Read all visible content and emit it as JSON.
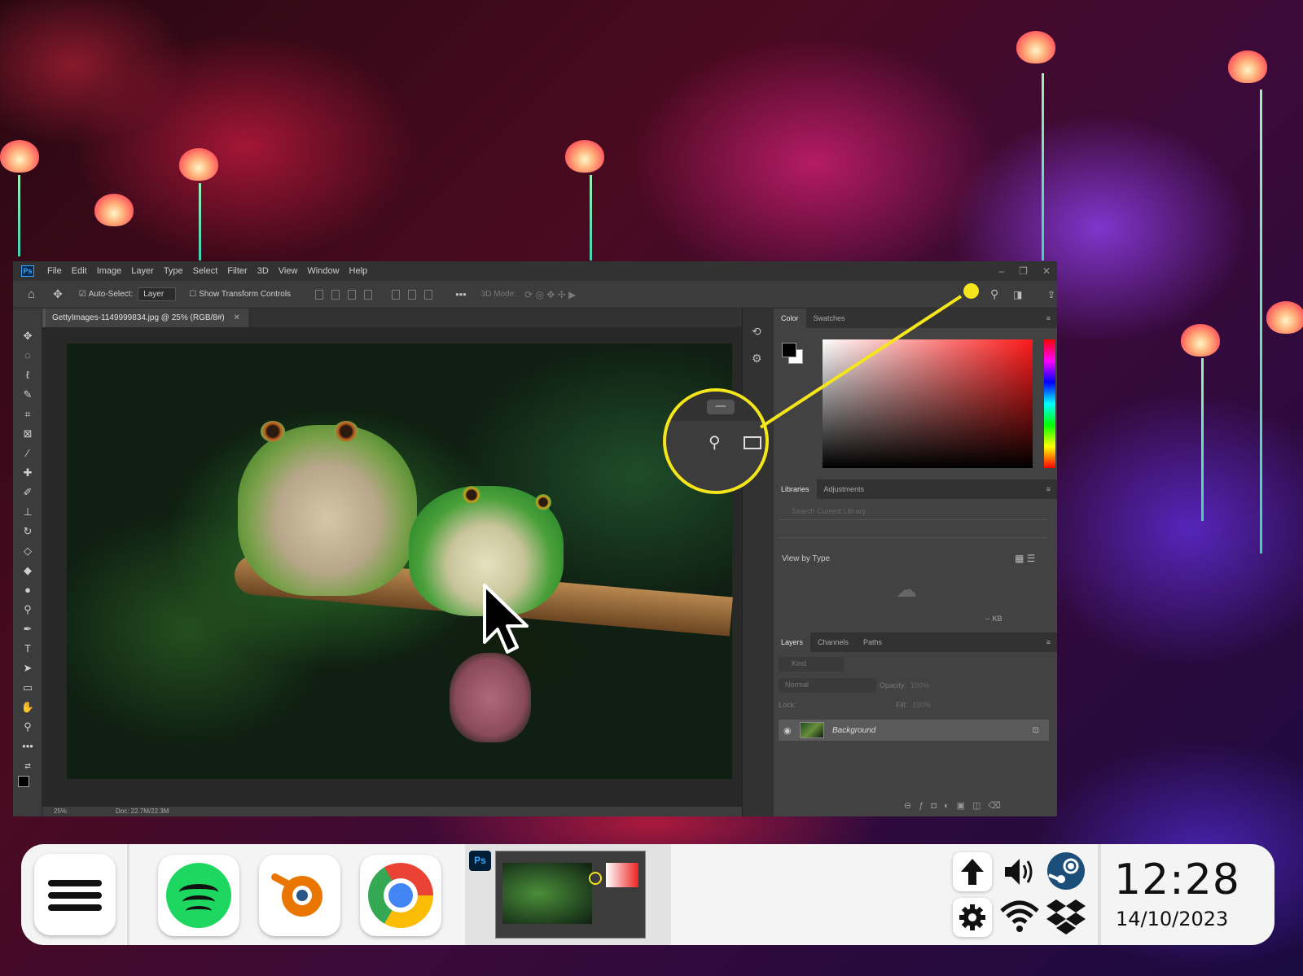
{
  "photoshop": {
    "logo": "Ps",
    "menu": [
      "File",
      "Edit",
      "Image",
      "Layer",
      "Type",
      "Select",
      "Filter",
      "3D",
      "View",
      "Window",
      "Help"
    ],
    "window_controls": {
      "minimize": "–",
      "restore": "❐",
      "close": "✕"
    },
    "options": {
      "auto_select_label": "Auto-Select:",
      "auto_select_value": "Layer",
      "transform_label": "Show Transform Controls",
      "mode_3d_label": "3D Mode:"
    },
    "document_tab": "GettyImages-1149999834.jpg @ 25% (RGB/8#)",
    "status": {
      "zoom": "25%",
      "doc": "Doc: 22.7M/22.3M"
    },
    "color_panel": {
      "tabs": [
        "Color",
        "Swatches"
      ],
      "fg_color": "#000000",
      "bg_color": "#ffffff"
    },
    "libraries_panel": {
      "tabs": [
        "Libraries",
        "Adjustments"
      ],
      "search_placeholder": "Search Current Library",
      "view_by": "View by Type",
      "size": "-- KB"
    },
    "layers_panel": {
      "tabs": [
        "Layers",
        "Channels",
        "Paths"
      ],
      "kind_label": "Kind",
      "blend_mode": "Normal",
      "opacity_label": "Opacity:",
      "opacity_value": "100%",
      "lock_label": "Lock:",
      "fill_label": "Fill:",
      "fill_value": "100%",
      "layer_name": "Background"
    },
    "highlight_color": "#f5e51c"
  },
  "taskbar": {
    "apps": [
      {
        "name": "Spotify",
        "icon": "spotify-icon"
      },
      {
        "name": "Blender",
        "icon": "blender-icon"
      },
      {
        "name": "Google Chrome",
        "icon": "chrome-icon"
      }
    ],
    "active_window": {
      "badge": "Ps"
    },
    "tray": [
      "upload-arrow-icon",
      "volume-icon",
      "steam-icon",
      "gear-icon",
      "wifi-icon",
      "dropbox-icon"
    ],
    "clock": {
      "time": "12:28",
      "date": "14/10/2023"
    }
  }
}
